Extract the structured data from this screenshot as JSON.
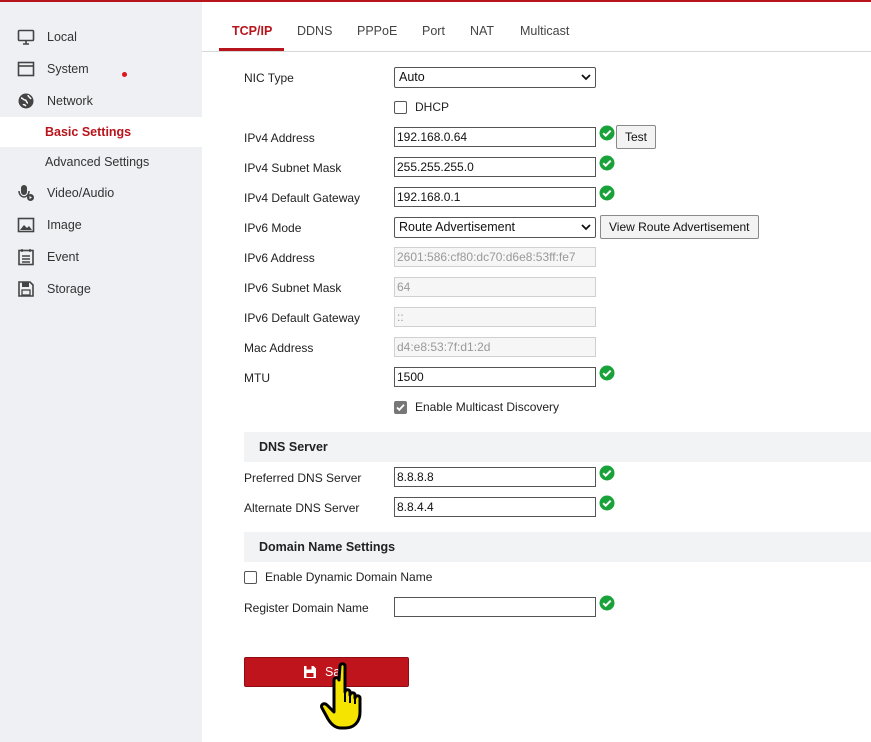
{
  "sidebar": {
    "items": [
      {
        "label": "Local",
        "icon": "monitor-icon"
      },
      {
        "label": "System",
        "icon": "window-icon"
      },
      {
        "label": "Network",
        "icon": "globe-icon"
      },
      {
        "label": "Basic Settings"
      },
      {
        "label": "Advanced Settings"
      },
      {
        "label": "Video/Audio",
        "icon": "microphone-camera-icon"
      },
      {
        "label": "Image",
        "icon": "image-icon"
      },
      {
        "label": "Event",
        "icon": "calendar-list-icon"
      },
      {
        "label": "Storage",
        "icon": "floppy-disk-icon"
      }
    ],
    "active": "Basic Settings"
  },
  "tabs": [
    "TCP/IP",
    "DDNS",
    "PPPoE",
    "Port",
    "NAT",
    "Multicast"
  ],
  "active_tab": "TCP/IP",
  "form": {
    "nic_type": {
      "label": "NIC Type",
      "value": "Auto"
    },
    "dhcp": {
      "label": "DHCP",
      "checked": false
    },
    "ipv4_address": {
      "label": "IPv4 Address",
      "value": "192.168.0.64"
    },
    "test_button": "Test",
    "ipv4_subnet": {
      "label": "IPv4 Subnet Mask",
      "value": "255.255.255.0"
    },
    "ipv4_gateway": {
      "label": "IPv4 Default Gateway",
      "value": "192.168.0.1"
    },
    "ipv6_mode": {
      "label": "IPv6 Mode",
      "value": "Route Advertisement"
    },
    "view_route_button": "View Route Advertisement",
    "ipv6_address": {
      "label": "IPv6 Address",
      "value": "2601:586:cf80:dc70:d6e8:53ff:fe7"
    },
    "ipv6_subnet": {
      "label": "IPv6 Subnet Mask",
      "value": "64"
    },
    "ipv6_gateway": {
      "label": "IPv6 Default Gateway",
      "value": "::"
    },
    "mac_address": {
      "label": "Mac Address",
      "value": "d4:e8:53:7f:d1:2d"
    },
    "mtu": {
      "label": "MTU",
      "value": "1500"
    },
    "multicast_discovery": {
      "label": "Enable Multicast Discovery",
      "checked": true
    }
  },
  "dns": {
    "title": "DNS Server",
    "preferred": {
      "label": "Preferred DNS Server",
      "value": "8.8.8.8"
    },
    "alternate": {
      "label": "Alternate DNS Server",
      "value": "8.8.4.4"
    }
  },
  "domain": {
    "title": "Domain Name Settings",
    "dynamic": {
      "label": "Enable Dynamic Domain Name",
      "checked": false
    },
    "register": {
      "label": "Register Domain Name",
      "value": ""
    }
  },
  "save_button": "Sa",
  "colors": {
    "accent": "#b8141c",
    "ok": "#1aa23a",
    "sidebar_bg": "#eef0f4"
  }
}
